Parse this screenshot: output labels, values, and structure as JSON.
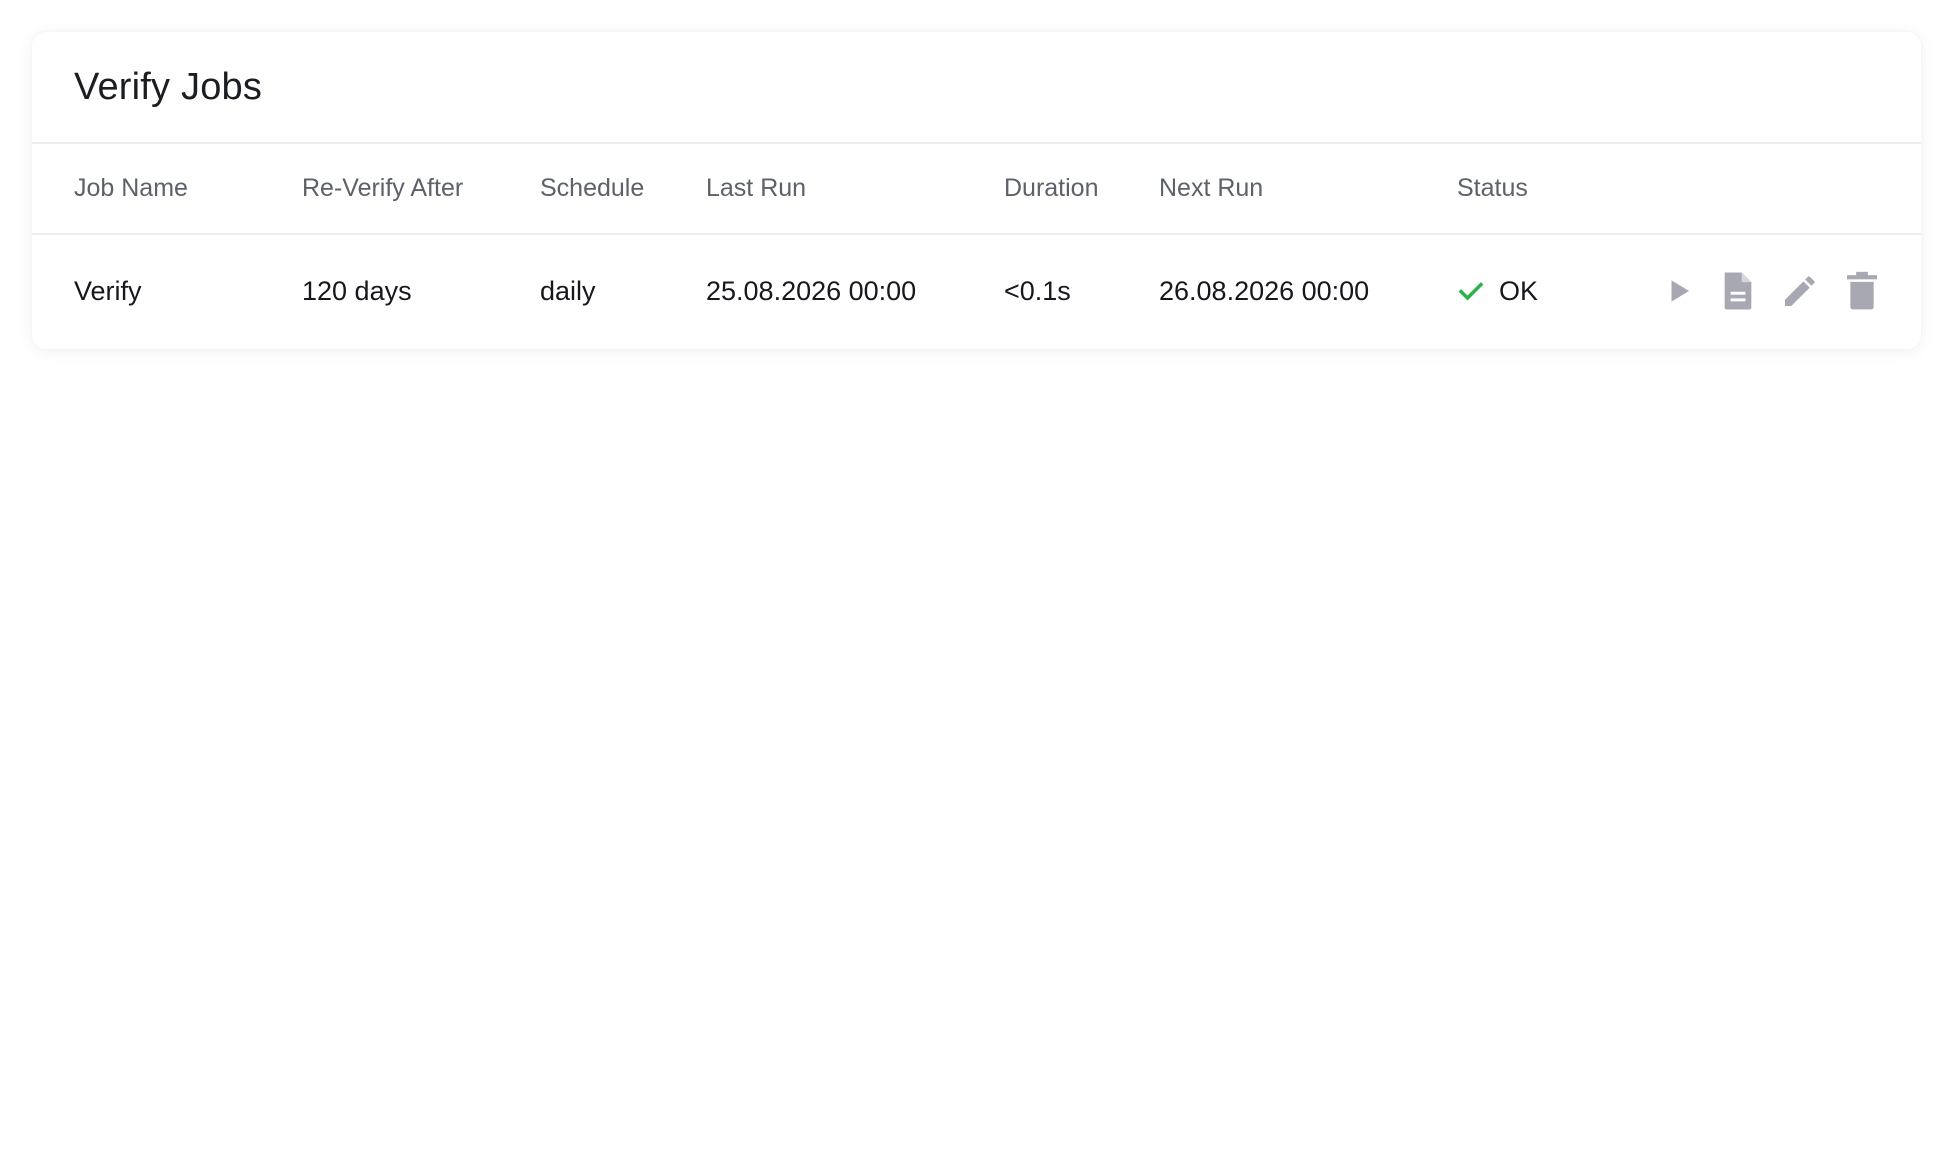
{
  "panel": {
    "title": "Verify Jobs"
  },
  "table": {
    "columns": [
      {
        "label": "Job Name"
      },
      {
        "label": "Re-Verify After"
      },
      {
        "label": "Schedule"
      },
      {
        "label": "Last Run"
      },
      {
        "label": "Duration"
      },
      {
        "label": "Next Run"
      },
      {
        "label": "Status"
      }
    ],
    "rows": [
      {
        "job_name": "Verify",
        "reverify_after": "120 days",
        "schedule": "daily",
        "last_run": "25.08.2026 00:00",
        "duration": "<0.1s",
        "next_run": "26.08.2026 00:00",
        "status": "OK",
        "status_icon": "check-icon",
        "actions": [
          {
            "icon": "play-icon"
          },
          {
            "icon": "document-icon"
          },
          {
            "icon": "pencil-icon"
          },
          {
            "icon": "trash-icon"
          }
        ]
      }
    ]
  },
  "colors": {
    "status_ok": "#2bb24c",
    "action_icon": "#a8a8b3",
    "title_text": "#1b1d22",
    "header_text": "#5d6169",
    "divider": "#eceef1"
  }
}
